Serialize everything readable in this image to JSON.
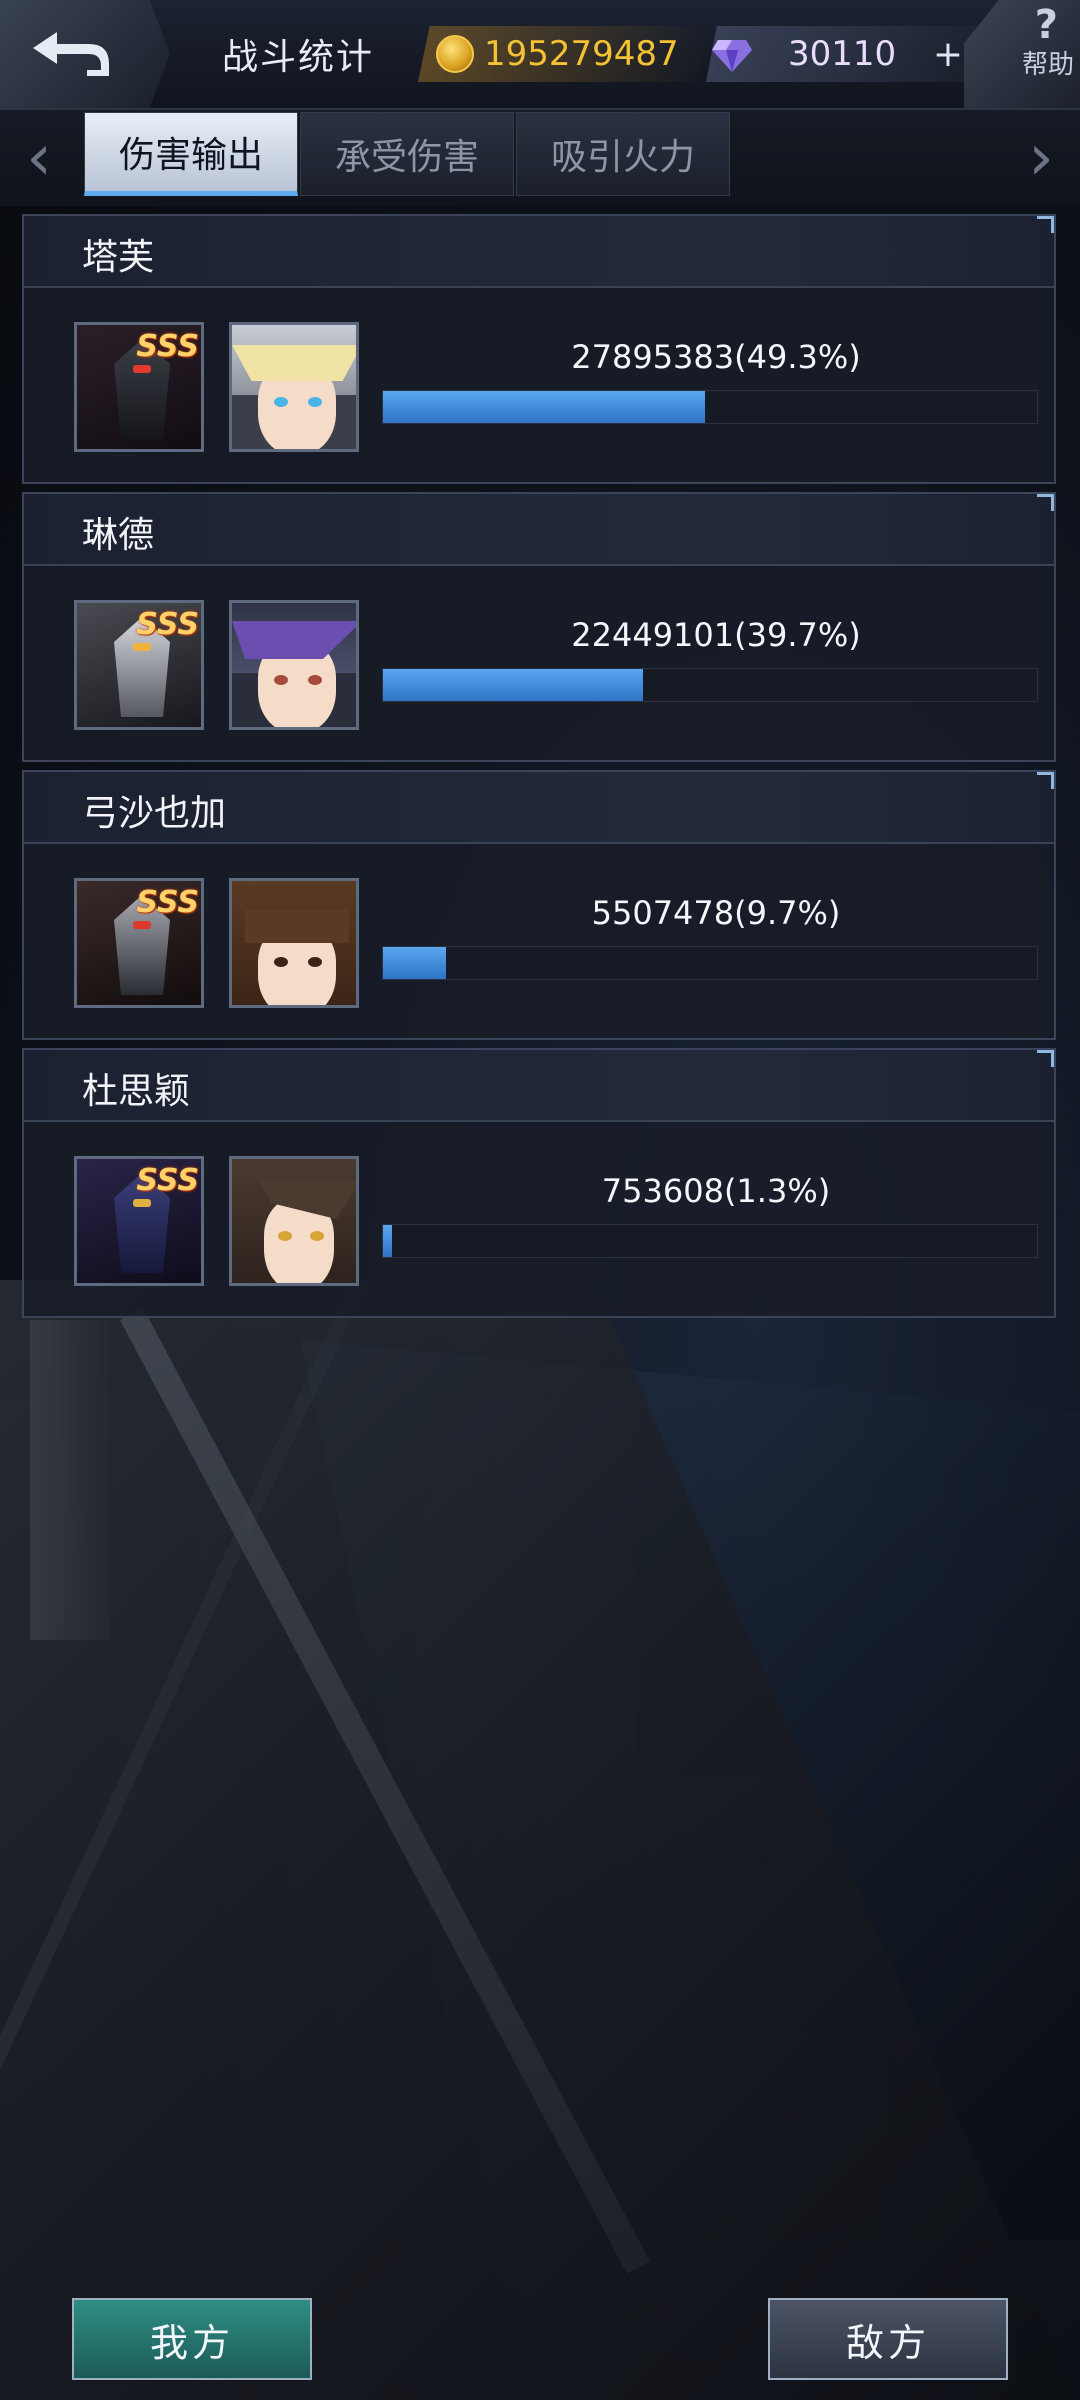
{
  "topbar": {
    "title": "战斗统计",
    "gold": "195279487",
    "gems": "30110",
    "plus": "+",
    "help_q": "?",
    "help_label": "帮助"
  },
  "tabs": [
    {
      "label": "伤害输出",
      "active": true
    },
    {
      "label": "承受伤害",
      "active": false
    },
    {
      "label": "吸引火力",
      "active": false
    }
  ],
  "rows": [
    {
      "name": "塔芙",
      "rank": "SSS",
      "value": "27895383(49.3%)",
      "percent": 49.3
    },
    {
      "name": "琳德",
      "rank": "SSS",
      "value": "22449101(39.7%)",
      "percent": 39.7
    },
    {
      "name": "弓沙也加",
      "rank": "SSS",
      "value": "5507478(9.7%)",
      "percent": 9.7
    },
    {
      "name": "杜思颖",
      "rank": "SSS",
      "value": "753608(1.3%)",
      "percent": 1.3
    }
  ],
  "bottom": {
    "our_side": "我方",
    "enemy_side": "敌方"
  },
  "colors": {
    "bar_fill": "#3d8be0",
    "gold_text": "#f4c233",
    "active_tab_underline": "#5fa9ef"
  }
}
